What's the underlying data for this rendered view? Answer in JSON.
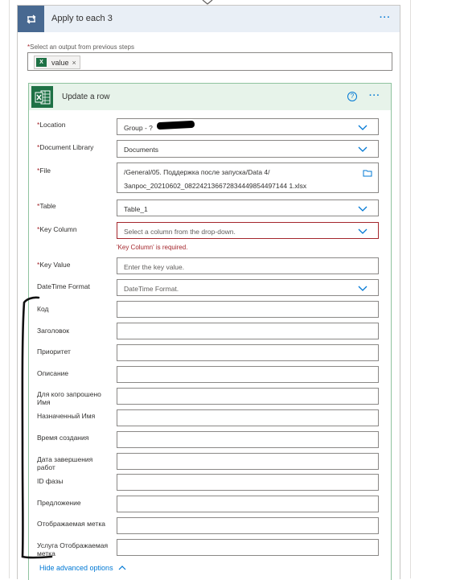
{
  "loop": {
    "title": "Apply to each 3",
    "select_label": "Select an output from previous steps",
    "token": {
      "icon_letter": "X",
      "label": "value",
      "remove": "×"
    },
    "menu": "···"
  },
  "action": {
    "title": "Update a row",
    "help": "?",
    "menu": "···",
    "fields": {
      "location": {
        "label": "Location",
        "value": "Group - ?"
      },
      "library": {
        "label": "Document Library",
        "value": "Documents"
      },
      "file": {
        "label": "File",
        "line1": "/General/05. Поддержка после запуска/Data 4/",
        "line2": "Запрос_20210602_082242136672834449854497144 1.xlsx"
      },
      "table": {
        "label": "Table",
        "value": "Table_1"
      },
      "key_column": {
        "label": "Key Column",
        "placeholder": "Select a column from the drop-down.",
        "error": "'Key Column' is required."
      },
      "key_value": {
        "label": "Key Value",
        "placeholder": "Enter the key value."
      },
      "datetime": {
        "label": "DateTime Format",
        "placeholder": "DateTime Format."
      }
    },
    "columns": [
      "Код",
      "Заголовок",
      "Приоритет",
      "Описание",
      "Для кого запрошено Имя",
      "Назначенный Имя",
      "Время создания",
      "Дата завершения работ",
      "ID фазы",
      "Предложение",
      "Отображаемая метка",
      "Услуга Отображаемая метка"
    ],
    "hide_advanced": "Hide advanced options"
  },
  "colors": {
    "loop_header": "#e9eff6",
    "loop_icon": "#486991",
    "excel_green": "#1e7145",
    "excel_header": "#e7f3ea",
    "link": "#0078d4",
    "error": "#a4262c"
  }
}
